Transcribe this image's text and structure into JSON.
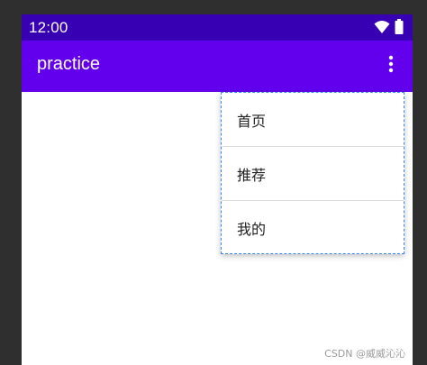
{
  "status_bar": {
    "time": "12:00",
    "icons": [
      "wifi-icon",
      "battery-icon"
    ]
  },
  "app_bar": {
    "title": "practice",
    "overflow_icon": "more-vert-icon"
  },
  "menu": {
    "items": [
      {
        "label": "首页"
      },
      {
        "label": "推荐"
      },
      {
        "label": "我的"
      }
    ]
  },
  "watermark": {
    "text": "CSDN @威威沁沁"
  },
  "colors": {
    "status_bar": "#3700b3",
    "app_bar": "#6200ee",
    "menu_border": "#3a86e8"
  }
}
